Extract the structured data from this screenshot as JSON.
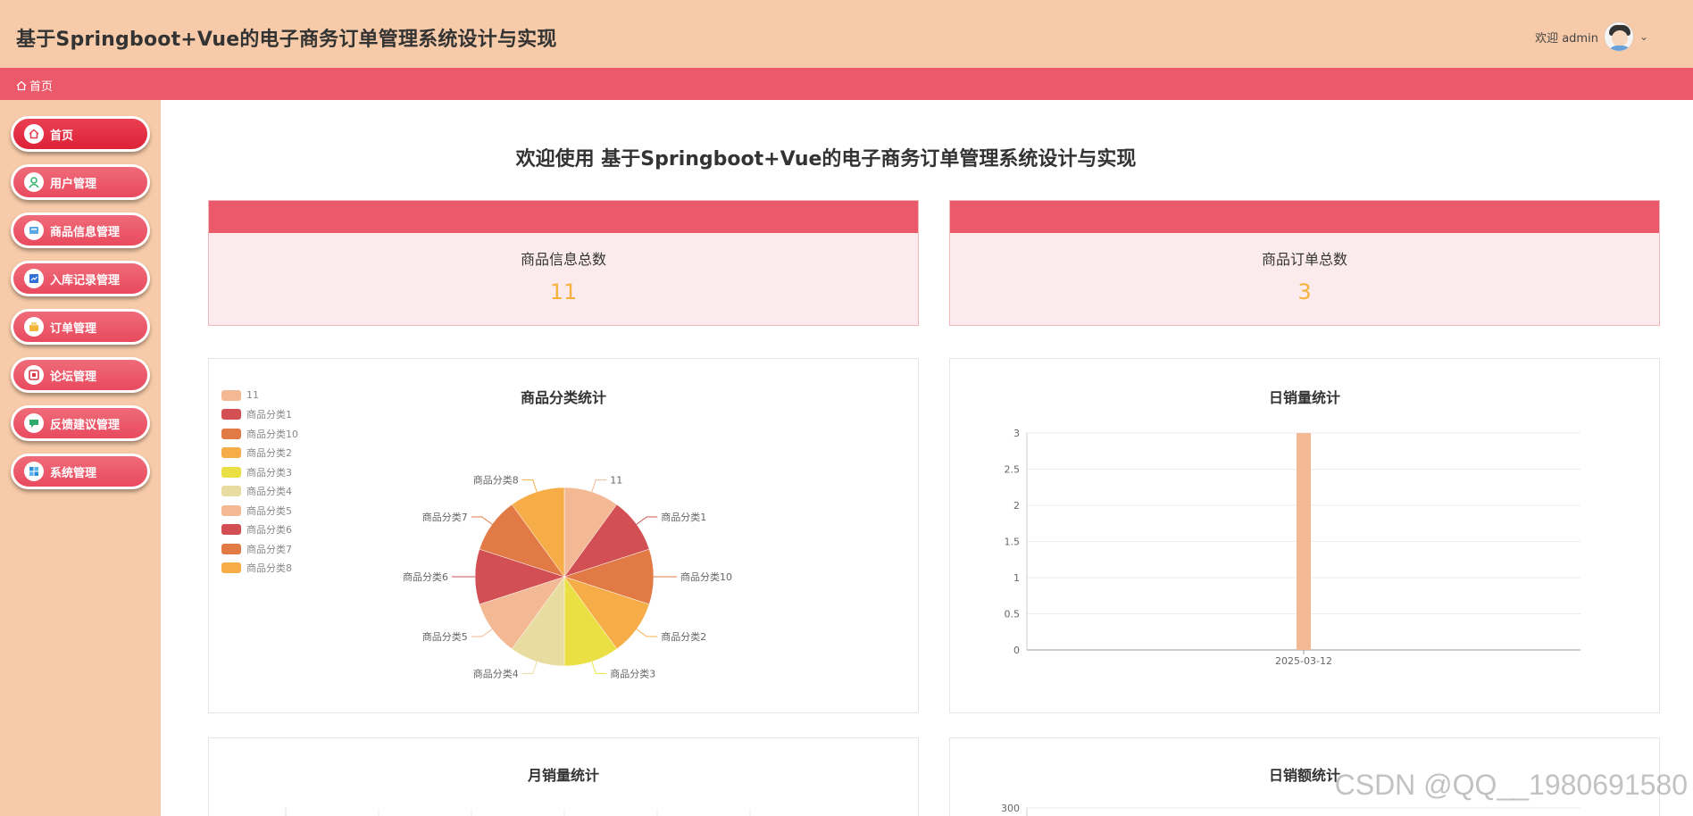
{
  "header": {
    "app_title": "基于Springboot+Vue的电子商务订单管理系统设计与实现",
    "welcome": "欢迎 admin",
    "chevron": "⌄"
  },
  "breadcrumb": {
    "icon": "home-icon",
    "label": "首页"
  },
  "sidebar": {
    "items": [
      {
        "label": "首页",
        "icon": "home-icon",
        "active": true
      },
      {
        "label": "用户管理",
        "icon": "user-icon"
      },
      {
        "label": "商品信息管理",
        "icon": "product-icon"
      },
      {
        "label": "入库记录管理",
        "icon": "inbound-icon"
      },
      {
        "label": "订单管理",
        "icon": "order-icon"
      },
      {
        "label": "论坛管理",
        "icon": "forum-icon"
      },
      {
        "label": "反馈建议管理",
        "icon": "feedback-icon"
      },
      {
        "label": "系统管理",
        "icon": "system-icon"
      }
    ]
  },
  "main": {
    "title": "欢迎使用 基于Springboot+Vue的电子商务订单管理系统设计与实现",
    "stats": [
      {
        "label": "商品信息总数",
        "value": "11"
      },
      {
        "label": "商品订单总数",
        "value": "3"
      }
    ],
    "panels": {
      "category": "商品分类统计",
      "daily_sales": "日销量统计",
      "monthly_sales": "月销量统计",
      "daily_revenue": "日销额统计"
    }
  },
  "colors": {
    "header": "#f7cba9",
    "accent": "#ea5a6b",
    "stat_value": "#f6b13a"
  },
  "chart_data": [
    {
      "type": "pie",
      "title": "商品分类统计",
      "categories": [
        "11",
        "商品分类1",
        "商品分类10",
        "商品分类2",
        "商品分类3",
        "商品分类4",
        "商品分类5",
        "商品分类6",
        "商品分类7",
        "商品分类8"
      ],
      "values": [
        1,
        1,
        1,
        1,
        1,
        1,
        1,
        1,
        1,
        1
      ],
      "colors": [
        "#f2b994",
        "#d24f53",
        "#e27a45",
        "#f6ad48",
        "#ebe043",
        "#e8dca0",
        "#f2b994",
        "#d24f53",
        "#e27a45",
        "#f6ad48"
      ],
      "legend": "top-left"
    },
    {
      "type": "bar",
      "title": "日销量统计",
      "categories": [
        "2025-03-12"
      ],
      "values": [
        3
      ],
      "ylim": [
        0,
        3
      ],
      "yticks": [
        "0",
        "0.5",
        "1",
        "1.5",
        "2",
        "2.5",
        "3"
      ],
      "color": "#f2b994"
    },
    {
      "type": "bar",
      "title": "日销额统计",
      "yticks_visible": [
        "300"
      ]
    },
    {
      "type": "line",
      "title": "月销量统计"
    }
  ],
  "watermark": "CSDN @QQ__1980691580"
}
